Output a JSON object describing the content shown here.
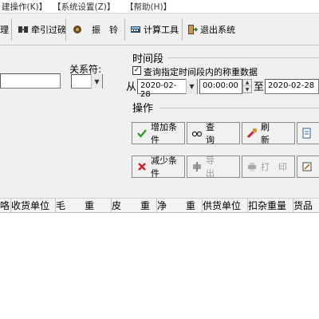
{
  "menu": {
    "items": [
      {
        "label": "建操作(K)】"
      },
      {
        "label": "【系统设置(Z)】"
      },
      {
        "label": "【帮助(H)】"
      }
    ]
  },
  "toolbar": {
    "buttons": [
      {
        "label": "理",
        "icon": "document-icon"
      },
      {
        "label": "牵引过磅",
        "icon": "traction-icon"
      },
      {
        "label": "振　铃",
        "icon": "bell-icon"
      },
      {
        "label": "计算工具",
        "icon": "calculator-icon"
      },
      {
        "label": "退出系统",
        "icon": "exit-icon"
      }
    ]
  },
  "form": {
    "relation_label": "关系符:",
    "relation_value": "",
    "left_input_value": ""
  },
  "time_range": {
    "title": "时间段",
    "checkbox_label": "查询指定时间段内的称重数据",
    "checked": true,
    "from_label": "从",
    "to_label": "至",
    "from_date": "2020-02-28",
    "from_time": "00:00:00",
    "to_date": "2020-02-28"
  },
  "operations": {
    "title": "操作",
    "buttons": [
      {
        "label": "增加条件",
        "icon": "check-icon",
        "enabled": true
      },
      {
        "label": "查　　询",
        "icon": "glasses-icon",
        "enabled": true
      },
      {
        "label": "刷　　新",
        "icon": "refresh-icon",
        "enabled": true
      },
      {
        "label": "",
        "icon": "edit-doc-icon",
        "enabled": true
      },
      {
        "label": "减少条件",
        "icon": "cross-icon",
        "enabled": true
      },
      {
        "label": "导　　出",
        "icon": "export-icon",
        "enabled": false
      },
      {
        "label": "打　印",
        "icon": "print-icon",
        "enabled": false
      },
      {
        "label": "",
        "icon": "edit-icon",
        "enabled": true
      }
    ]
  },
  "grid": {
    "columns": [
      "咯",
      "收货单位",
      "毛　　重",
      "皮　　重",
      "净　　重",
      "供货单位",
      "扣杂重量",
      "货品"
    ],
    "rows": []
  },
  "colors": {
    "accent_green": "#2a9a2a",
    "accent_red": "#d42020"
  }
}
